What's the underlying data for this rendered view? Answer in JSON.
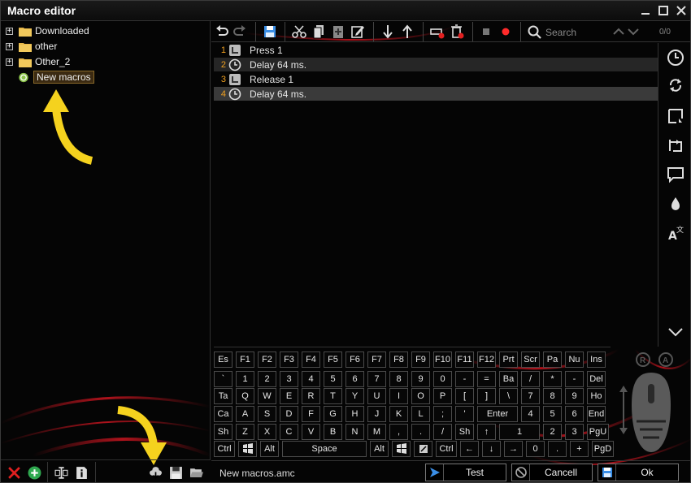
{
  "window": {
    "title": "Macro editor"
  },
  "tree": {
    "items": [
      {
        "label": "Downloaded",
        "expandable": true
      },
      {
        "label": "other",
        "expandable": true
      },
      {
        "label": "Other_2",
        "expandable": true
      },
      {
        "label": "New macros",
        "expandable": false,
        "selected": true
      }
    ]
  },
  "toolbar": {
    "icons": [
      "undo-icon",
      "redo-icon",
      "save-icon",
      "cut-icon",
      "copy-icon",
      "paste-icon",
      "edit-icon",
      "move-down-icon",
      "move-up-icon",
      "delete-icon",
      "delete-all-icon",
      "stop-icon",
      "record-icon",
      "search-icon"
    ],
    "search_placeholder": "Search",
    "match_count": "0/0"
  },
  "macro_steps": [
    {
      "num": "1",
      "type": "key",
      "text": "Press 1"
    },
    {
      "num": "2",
      "type": "delay",
      "text": "Delay 64 ms."
    },
    {
      "num": "3",
      "type": "key",
      "text": "Release 1"
    },
    {
      "num": "4",
      "type": "delay",
      "text": "Delay 64 ms."
    }
  ],
  "side_tools": [
    "delay-icon",
    "loop-icon",
    "jump-icon",
    "repeat-icon",
    "comment-icon",
    "drop-icon",
    "text-icon",
    "expand-down-icon"
  ],
  "keyboard": {
    "rows": [
      [
        "Es",
        "F1",
        "F2",
        "F3",
        "F4",
        "F5",
        "F6",
        "F7",
        "F8",
        "F9",
        "F10",
        "F11",
        "F12",
        "Prt",
        "Scr",
        "Pa",
        "Nu",
        "Ins"
      ],
      [
        "`",
        "1",
        "2",
        "3",
        "4",
        "5",
        "6",
        "7",
        "8",
        "9",
        "0",
        "-",
        "=",
        "Ba",
        "/",
        "*",
        "-",
        "Del"
      ],
      [
        "Ta",
        "Q",
        "W",
        "E",
        "R",
        "T",
        "Y",
        "U",
        "I",
        "O",
        "P",
        "[",
        "]",
        "\\",
        "7",
        "8",
        "9",
        "Ho"
      ],
      [
        "Ca",
        "A",
        "S",
        "D",
        "F",
        "G",
        "H",
        "J",
        "K",
        "L",
        ";",
        "'",
        "Enter",
        "4",
        "5",
        "6",
        "End"
      ],
      [
        "Sh",
        "Z",
        "X",
        "C",
        "V",
        "B",
        "N",
        "M",
        ",",
        ".",
        "/",
        "Sh",
        "↑",
        "1",
        "2",
        "3",
        "PgU"
      ],
      [
        "Ctrl",
        "",
        "Alt",
        "Space",
        "Alt",
        "",
        "",
        "Ctrl",
        "←",
        "↓",
        "→",
        "0",
        ".",
        "+",
        "PgD"
      ]
    ]
  },
  "status": {
    "filename": "New macros.amc",
    "test_label": "Test",
    "cancel_label": "Cancell",
    "ok_label": "Ok"
  },
  "colors": {
    "accent": "#f0a020",
    "record": "#ff2a2a",
    "art": "#c0141e"
  }
}
